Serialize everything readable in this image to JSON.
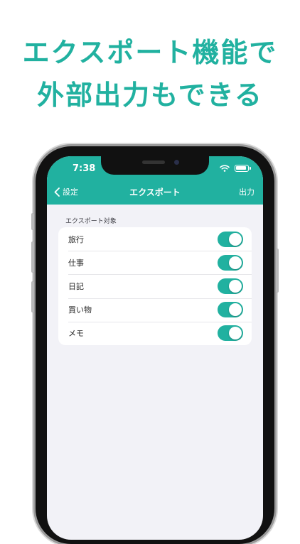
{
  "headline": {
    "line1": "エクスポート機能で",
    "line2": "外部出力もできる"
  },
  "status_bar": {
    "time": "7:38"
  },
  "nav": {
    "back_label": "設定",
    "title": "エクスポート",
    "action_label": "出力"
  },
  "export": {
    "section_label": "エクスポート対象",
    "items": [
      {
        "label": "旅行",
        "enabled": true
      },
      {
        "label": "仕事",
        "enabled": true
      },
      {
        "label": "日記",
        "enabled": true
      },
      {
        "label": "買い物",
        "enabled": true
      },
      {
        "label": "メモ",
        "enabled": true
      }
    ]
  },
  "colors": {
    "accent": "#21b1a0",
    "background": "#f2f2f7"
  }
}
